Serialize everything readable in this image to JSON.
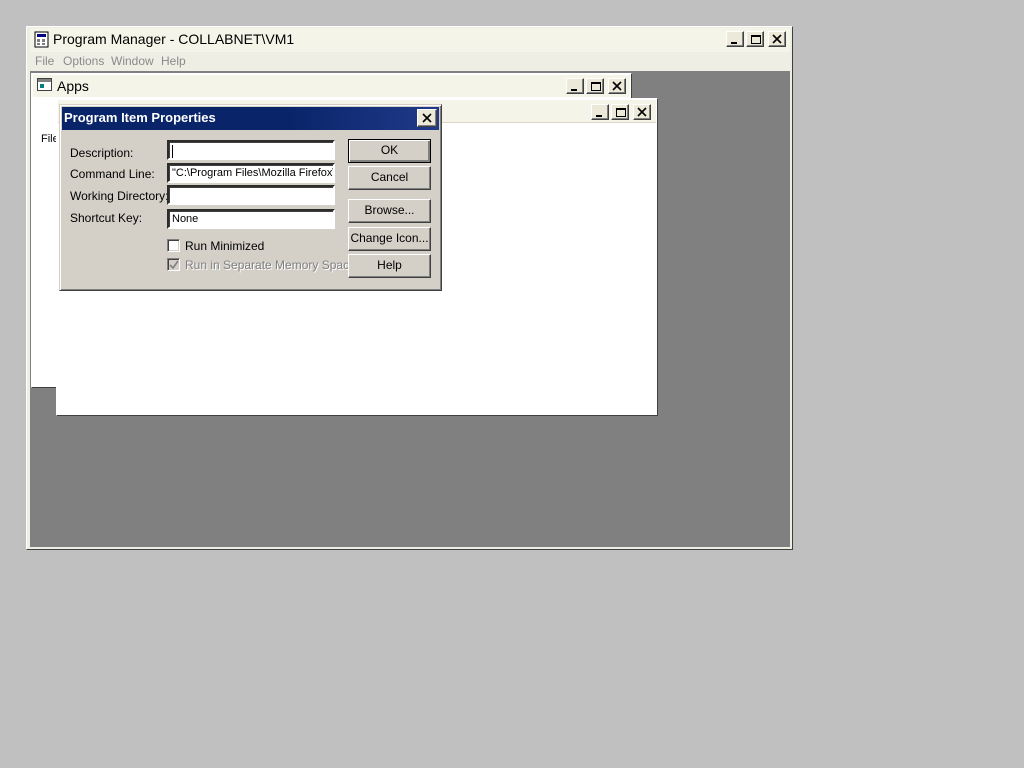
{
  "program_manager": {
    "title": "Program Manager - COLLABNET\\VM1",
    "menu": [
      "File",
      "Options",
      "Window",
      "Help"
    ]
  },
  "apps_window": {
    "title": "Apps",
    "partial_menu_text": "File"
  },
  "dialog": {
    "title": "Program Item Properties",
    "fields": {
      "description": {
        "label": "Description:",
        "value": ""
      },
      "command_line": {
        "label": "Command Line:",
        "value": "\"C:\\Program Files\\Mozilla Firefox\\f"
      },
      "working_directory": {
        "label": "Working Directory:",
        "value": ""
      },
      "shortcut_key": {
        "label": "Shortcut Key:",
        "value": "None"
      }
    },
    "checkboxes": {
      "run_minimized": {
        "label": "Run Minimized",
        "checked": false,
        "enabled": true
      },
      "separate_memory": {
        "label": "Run in Separate Memory Space",
        "checked": true,
        "enabled": false
      }
    },
    "buttons": {
      "ok": "OK",
      "cancel": "Cancel",
      "browse": "Browse...",
      "change_icon": "Change Icon...",
      "help": "Help"
    }
  },
  "colors": {
    "desktop": "#c0c0c0",
    "title_bar_active": "#0a246a",
    "mdi_background": "#808080",
    "dialog_face": "#d4d0c8"
  },
  "icons": [
    "program-manager-icon",
    "group-window-icon",
    "minimize-icon",
    "maximize-icon",
    "close-icon",
    "checkmark-icon"
  ]
}
